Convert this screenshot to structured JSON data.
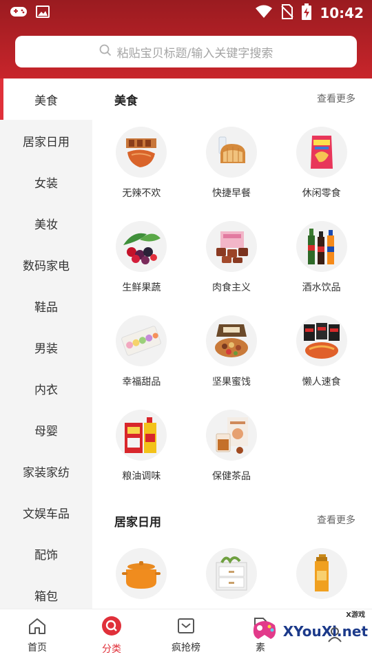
{
  "status": {
    "time": "10:42"
  },
  "search": {
    "placeholder": "粘贴宝贝标题/输入关键字搜索"
  },
  "sidebar": {
    "items": [
      {
        "label": "美食"
      },
      {
        "label": "居家日用"
      },
      {
        "label": "女装"
      },
      {
        "label": "美妆"
      },
      {
        "label": "数码家电"
      },
      {
        "label": "鞋品"
      },
      {
        "label": "男装"
      },
      {
        "label": "内衣"
      },
      {
        "label": "母婴"
      },
      {
        "label": "家装家纺"
      },
      {
        "label": "文娱车品"
      },
      {
        "label": "配饰"
      },
      {
        "label": "箱包"
      }
    ]
  },
  "sections": [
    {
      "title": "美食",
      "more": "查看更多",
      "items": [
        {
          "label": "无辣不欢"
        },
        {
          "label": "快捷早餐"
        },
        {
          "label": "休闲零食"
        },
        {
          "label": "生鲜果蔬"
        },
        {
          "label": "肉食主义"
        },
        {
          "label": "酒水饮品"
        },
        {
          "label": "幸福甜品"
        },
        {
          "label": "坚果蜜饯"
        },
        {
          "label": "懒人速食"
        },
        {
          "label": "粮油调味"
        },
        {
          "label": "保健茶品"
        }
      ]
    },
    {
      "title": "居家日用",
      "more": "查看更多"
    }
  ],
  "tabs": [
    {
      "label": "首页"
    },
    {
      "label": "分类"
    },
    {
      "label": "疯抢榜"
    },
    {
      "label": "素"
    }
  ],
  "watermark": {
    "text": "XYouXi.net",
    "small": "X游戏"
  },
  "colors": {
    "accent": "#e0303a",
    "header_top": "#9a1b20",
    "header_bottom": "#c8252b"
  }
}
